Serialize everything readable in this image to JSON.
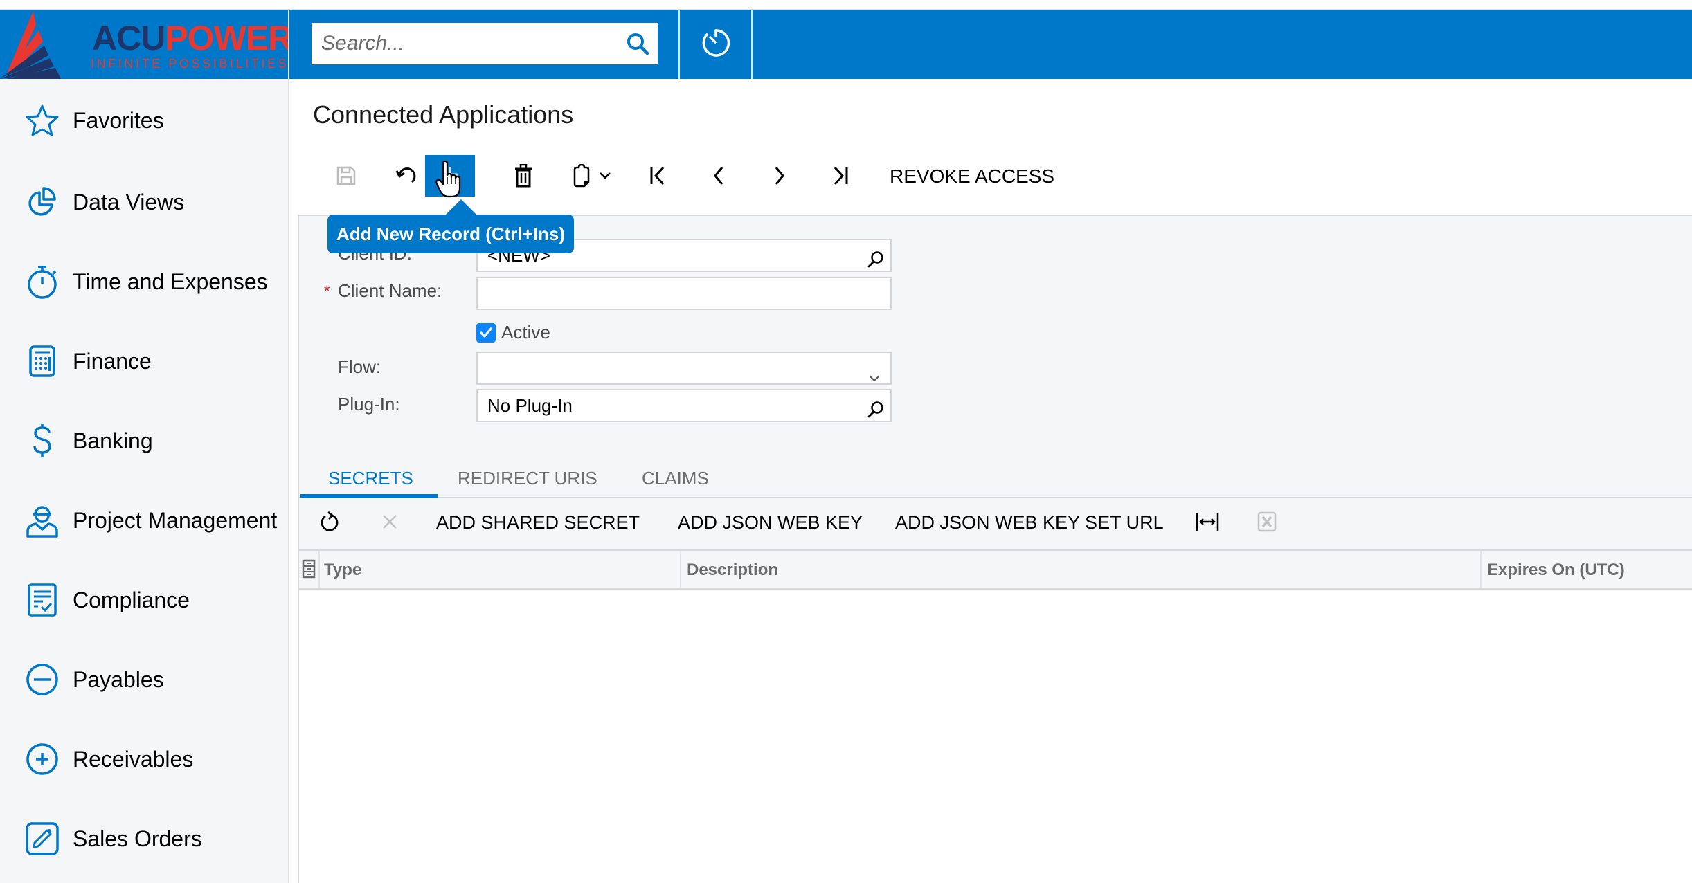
{
  "header": {
    "logo": {
      "part1": "ACU",
      "part2": "POWER",
      "tagline": "INFINITE POSSIBILITIES"
    },
    "search": {
      "placeholder": "Search...",
      "value": ""
    },
    "icons": {
      "search": "search-icon",
      "timer": "timer-icon"
    }
  },
  "colors": {
    "brand_blue": "#0078c9",
    "logo_navy": "#1f3569",
    "logo_red": "#e8382f",
    "required": "#e02020",
    "sidebar_bg": "#f5f6f8"
  },
  "sidebar": {
    "items": [
      {
        "label": "Favorites",
        "icon": "star-icon"
      },
      {
        "label": "Data Views",
        "icon": "pie-chart-icon"
      },
      {
        "label": "Time and Expenses",
        "icon": "stopwatch-icon"
      },
      {
        "label": "Finance",
        "icon": "calculator-icon"
      },
      {
        "label": "Banking",
        "icon": "dollar-icon"
      },
      {
        "label": "Project Management",
        "icon": "worker-icon"
      },
      {
        "label": "Compliance",
        "icon": "checklist-icon"
      },
      {
        "label": "Payables",
        "icon": "minus-circle-icon"
      },
      {
        "label": "Receivables",
        "icon": "plus-circle-icon"
      },
      {
        "label": "Sales Orders",
        "icon": "edit-icon"
      }
    ]
  },
  "page": {
    "title": "Connected Applications",
    "toolbar": {
      "buttons": [
        {
          "name": "save",
          "icon": "save-icon",
          "enabled": false
        },
        {
          "name": "cancel",
          "icon": "undo-icon",
          "enabled": true
        },
        {
          "name": "add-new-record",
          "icon": "add-icon",
          "enabled": true,
          "hovered": true
        },
        {
          "name": "delete",
          "icon": "trash-icon",
          "enabled": true
        },
        {
          "name": "copy-paste",
          "icon": "clipboard-icon",
          "enabled": true
        },
        {
          "name": "first",
          "icon": "first-page-icon",
          "enabled": true
        },
        {
          "name": "previous",
          "icon": "chevron-left-icon",
          "enabled": true
        },
        {
          "name": "next",
          "icon": "chevron-right-icon",
          "enabled": true
        },
        {
          "name": "last",
          "icon": "last-page-icon",
          "enabled": true
        }
      ],
      "revoke_access": "REVOKE ACCESS"
    },
    "tooltip": "Add New Record (Ctrl+Ins)",
    "form": {
      "client_id": {
        "label": "Client ID:",
        "value": "<NEW>"
      },
      "client_name": {
        "label": "Client Name:",
        "value": "",
        "required_mark": "*"
      },
      "active": {
        "label": "Active",
        "checked": true
      },
      "flow": {
        "label": "Flow:",
        "value": ""
      },
      "plugin": {
        "label": "Plug-In:",
        "value": "No Plug-In"
      }
    },
    "tabs": [
      {
        "label": "SECRETS",
        "active": true
      },
      {
        "label": "REDIRECT URIS",
        "active": false
      },
      {
        "label": "CLAIMS",
        "active": false
      }
    ],
    "grid_toolbar": {
      "add_shared_secret": "ADD SHARED SECRET",
      "add_json_web_key": "ADD JSON WEB KEY",
      "add_json_web_key_set_url": "ADD JSON WEB KEY SET URL"
    },
    "grid": {
      "columns": [
        "Type",
        "Description",
        "Expires On (UTC)"
      ],
      "rows": []
    }
  }
}
